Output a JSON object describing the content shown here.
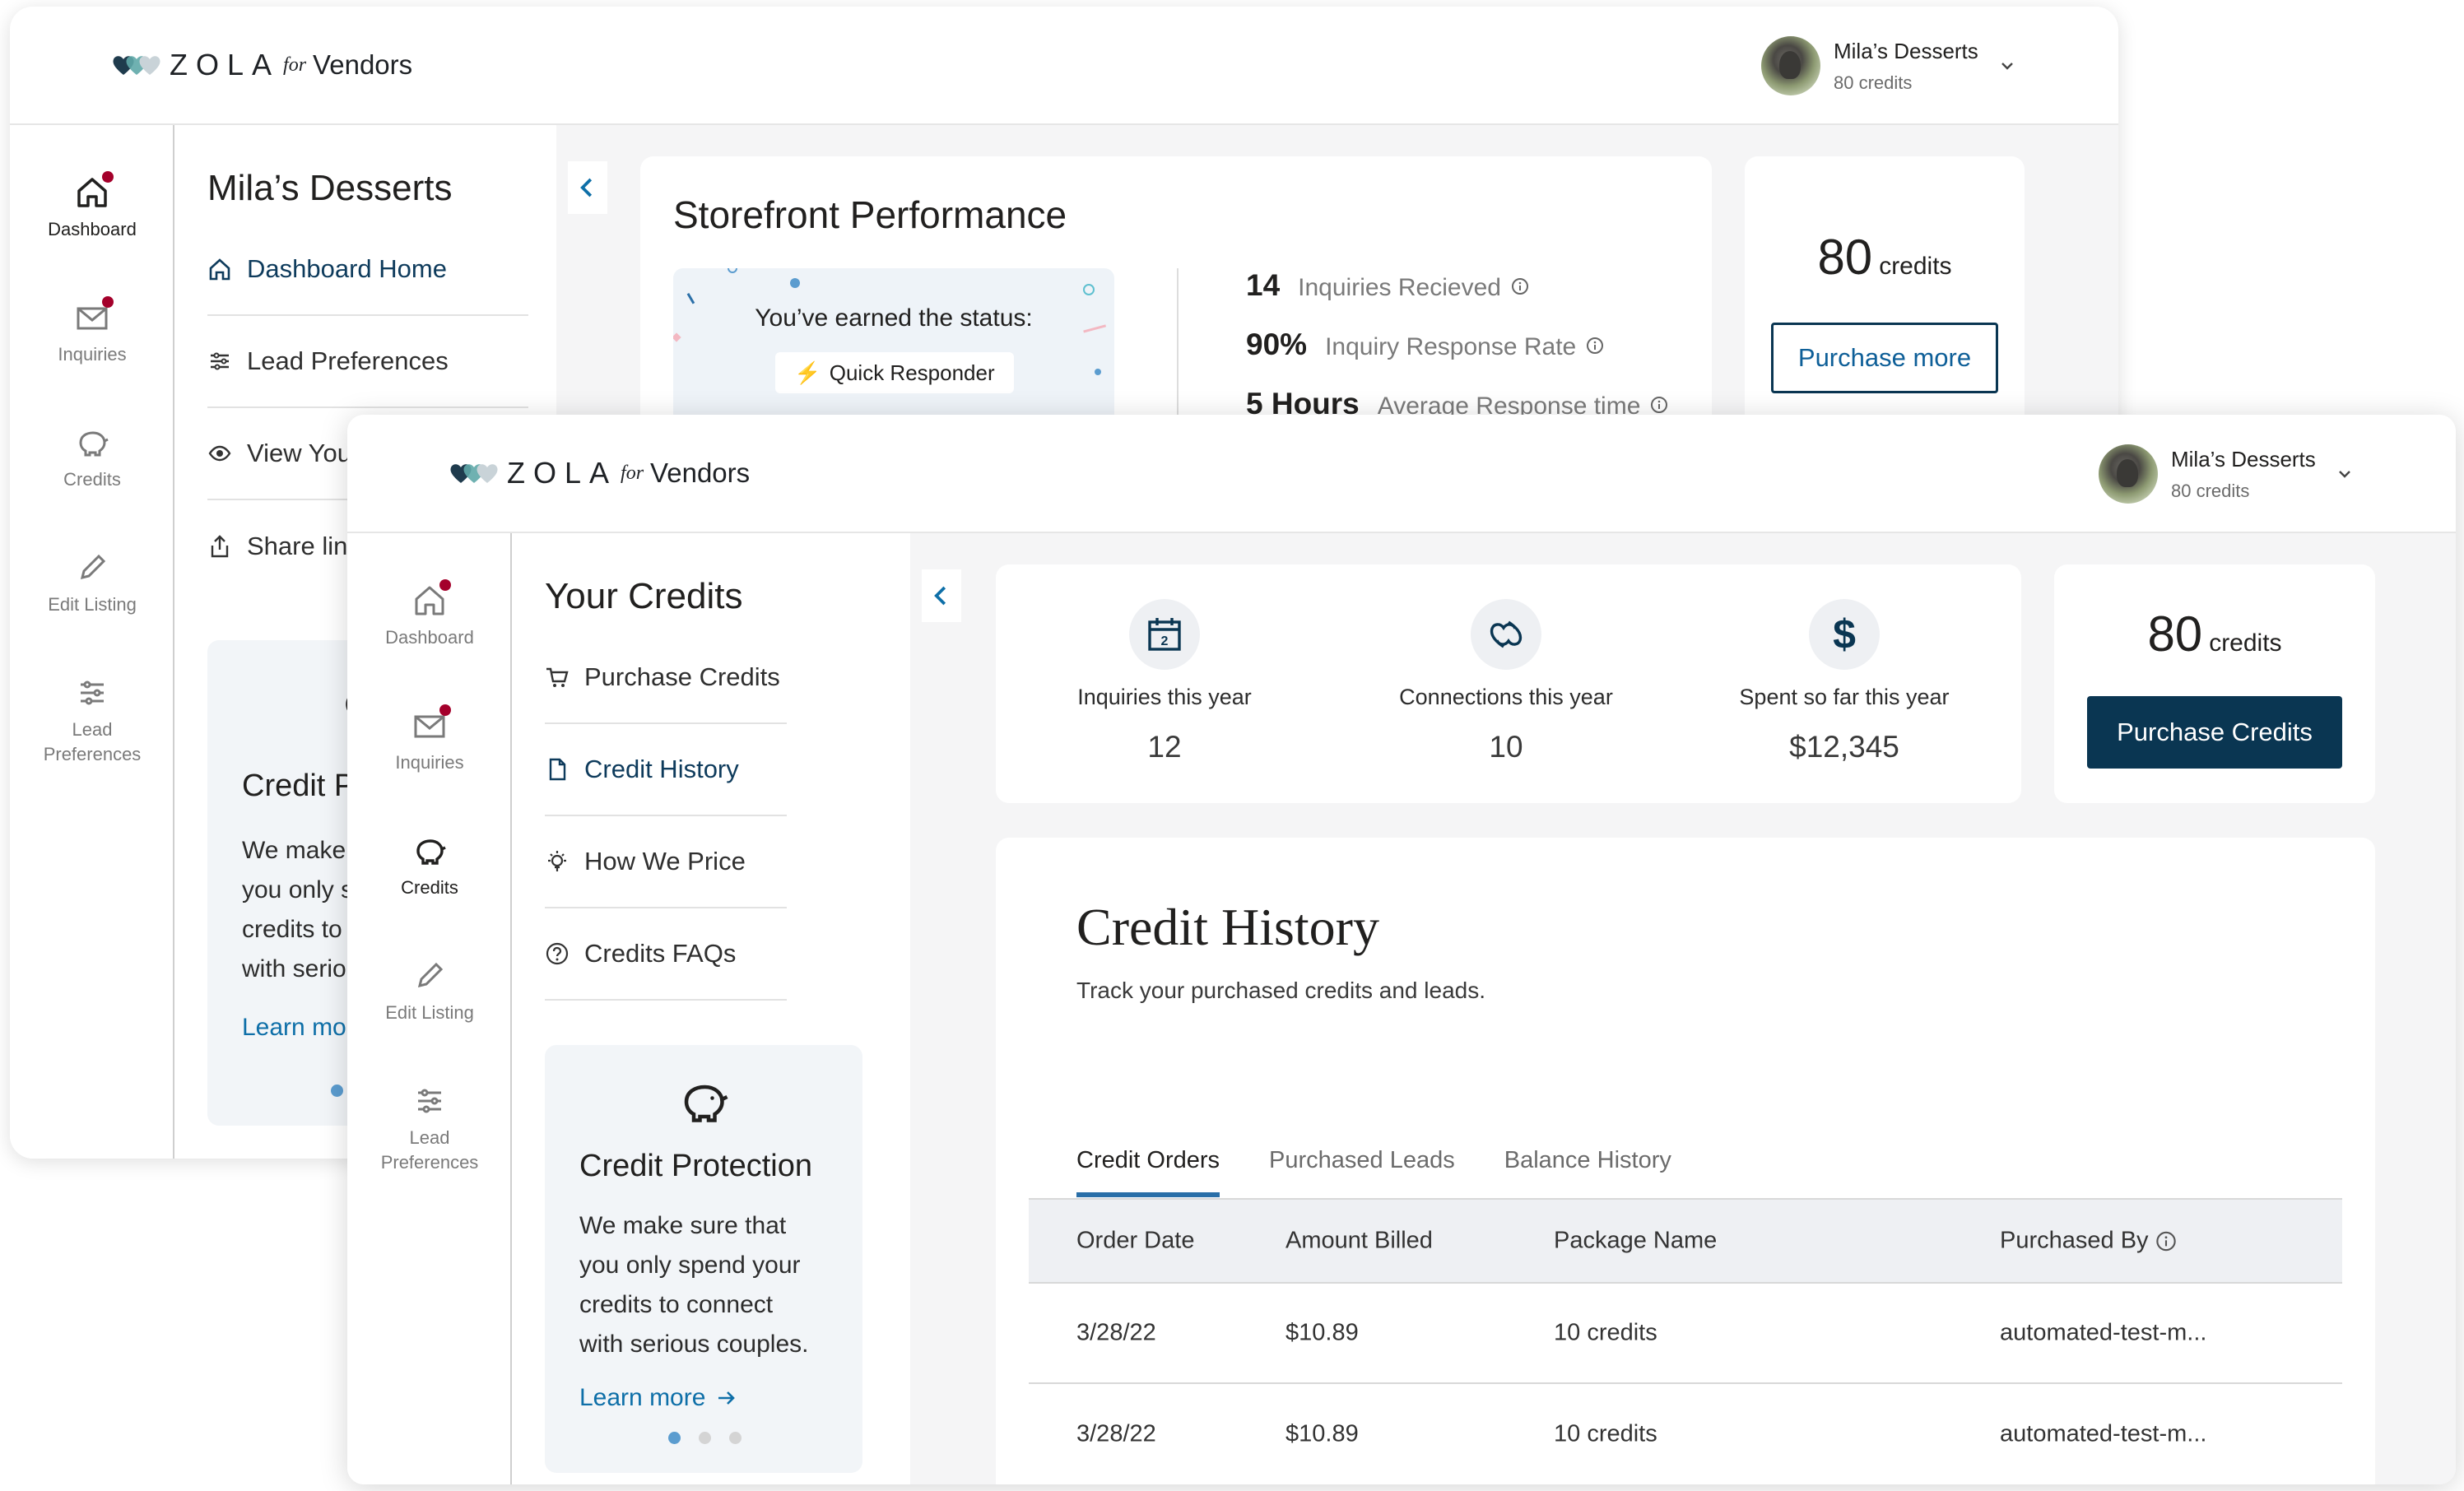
{
  "back_window": {
    "brand": {
      "word": "ZOLA",
      "for": "for",
      "vendors": "Vendors"
    },
    "account": {
      "name": "Mila’s Desserts",
      "credits": "80 credits"
    },
    "rail": [
      {
        "label": "Dashboard",
        "icon": "home-icon",
        "active": true,
        "badge": true
      },
      {
        "label": "Inquiries",
        "icon": "envelope-icon",
        "badge": true
      },
      {
        "label": "Credits",
        "icon": "piggy-bank-icon"
      },
      {
        "label": "Edit Listing",
        "icon": "pencil-icon"
      },
      {
        "label": "Lead",
        "label2": "Preferences",
        "icon": "sliders-icon"
      }
    ],
    "subnav": {
      "title": "Mila’s Desserts",
      "items": [
        {
          "label": "Dashboard Home",
          "icon": "home-icon"
        },
        {
          "label": "Lead Preferences",
          "icon": "sliders-icon"
        },
        {
          "label": "View You",
          "icon": "eye-icon"
        },
        {
          "label": "Share lin",
          "icon": "share-icon"
        }
      ]
    },
    "promo": {
      "title": "Credit P",
      "lines": [
        "We make",
        "you only s",
        "credits to",
        "with serio"
      ],
      "link": "Learn mo"
    },
    "performance": {
      "title": "Storefront Performance",
      "status_text": "You’ve earned the status:",
      "badge": "Quick Responder",
      "stats": [
        {
          "value": "14",
          "label": "Inquiries Recieved"
        },
        {
          "value": "90%",
          "label": "Inquiry Response Rate"
        },
        {
          "value": "5 Hours",
          "label": "Average Response time"
        }
      ]
    },
    "credits_card": {
      "number": "80",
      "unit": "credits",
      "button": "Purchase more"
    }
  },
  "front_window": {
    "brand": {
      "word": "ZOLA",
      "for": "for",
      "vendors": "Vendors"
    },
    "account": {
      "name": "Mila’s Desserts",
      "credits": "80 credits"
    },
    "rail": [
      {
        "label": "Dashboard",
        "icon": "home-icon",
        "badge": true
      },
      {
        "label": "Inquiries",
        "icon": "envelope-icon",
        "badge": true
      },
      {
        "label": "Credits",
        "icon": "piggy-bank-icon",
        "active": true
      },
      {
        "label": "Edit Listing",
        "icon": "pencil-icon"
      },
      {
        "label": "Lead",
        "label2": "Preferences",
        "icon": "sliders-icon"
      }
    ],
    "subnav": {
      "title": "Your Credits",
      "items": [
        {
          "label": "Purchase Credits",
          "icon": "cart-icon"
        },
        {
          "label": "Credit History",
          "icon": "document-icon",
          "active": true
        },
        {
          "label": "How We Price",
          "icon": "lightbulb-icon"
        },
        {
          "label": "Credits FAQs",
          "icon": "question-icon"
        }
      ]
    },
    "promo": {
      "title": "Credit Protection",
      "lines": [
        "We make sure that",
        "you only spend your",
        "credits to connect",
        "with serious couples."
      ],
      "link": "Learn more"
    },
    "stats": [
      {
        "label": "Inquiries this year",
        "value": "12",
        "icon": "calendar-icon"
      },
      {
        "label": "Connections this year",
        "value": "10",
        "icon": "linked-hearts-icon"
      },
      {
        "label": "Spent so far this year",
        "value": "$12,345",
        "icon": "dollar-icon"
      }
    ],
    "credits_card": {
      "number": "80",
      "unit": "credits",
      "button": "Purchase Credits"
    },
    "history": {
      "title": "Credit History",
      "subtitle": "Track your purchased credits and leads.",
      "tabs": [
        "Credit Orders",
        "Purchased Leads",
        "Balance History"
      ],
      "columns": [
        "Order Date",
        "Amount Billed",
        "Package Name",
        "Purchased By"
      ],
      "rows": [
        [
          "3/28/22",
          "$10.89",
          "10 credits",
          "automated-test-m..."
        ],
        [
          "3/28/22",
          "$10.89",
          "10 credits",
          "automated-test-m..."
        ]
      ]
    }
  },
  "colors": {
    "navy": "#0a3652",
    "link": "#0e6fa8",
    "badge": "#a4002b",
    "tab_underline": "#2a6fa8"
  }
}
